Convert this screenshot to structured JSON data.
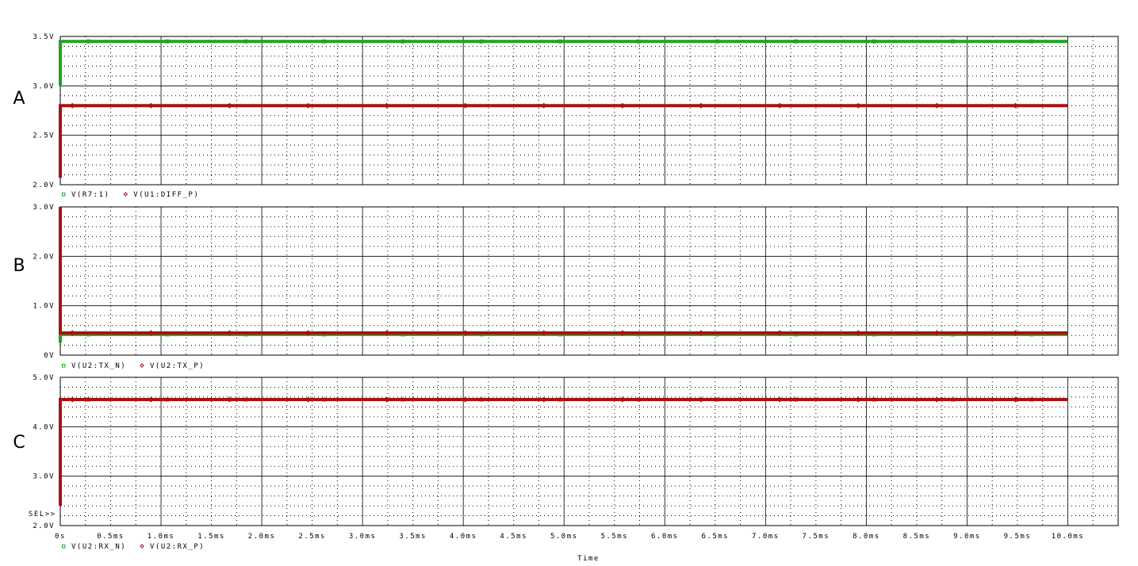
{
  "time_label": "Time",
  "sel_label": "SEL>>",
  "x_ticks": [
    "0s",
    "0.5ms",
    "1.0ms",
    "1.5ms",
    "2.0ms",
    "2.5ms",
    "3.0ms",
    "3.5ms",
    "4.0ms",
    "4.5ms",
    "5.0ms",
    "5.5ms",
    "6.0ms",
    "6.5ms",
    "7.0ms",
    "7.5ms",
    "8.0ms",
    "8.5ms",
    "9.0ms",
    "9.5ms",
    "10.0ms"
  ],
  "colors": {
    "green": "#1fa51f",
    "red": "#aa1111",
    "grid": "#000000"
  },
  "chart_data": [
    {
      "type": "line",
      "panel_label": "A",
      "x_unit": "ms",
      "xlim": [
        0,
        10.5
      ],
      "ylim": [
        2.0,
        3.5
      ],
      "y_ticks": [
        "2.0V",
        "2.5V",
        "3.0V",
        "3.5V"
      ],
      "y_tick_values": [
        2.0,
        2.5,
        3.0,
        3.5
      ],
      "series": [
        {
          "name": "V(R7:1)",
          "color": "green",
          "marker": "square",
          "x": [
            0,
            0,
            10.0
          ],
          "y": [
            3.0,
            3.45,
            3.45
          ]
        },
        {
          "name": "V(U1:DIFF_P)",
          "color": "red",
          "marker": "diamond",
          "x": [
            0,
            0,
            10.0
          ],
          "y": [
            2.07,
            2.8,
            2.8
          ]
        }
      ]
    },
    {
      "type": "line",
      "panel_label": "B",
      "x_unit": "ms",
      "xlim": [
        0,
        10.5
      ],
      "ylim": [
        0,
        3.0
      ],
      "y_ticks": [
        "0V",
        "1.0V",
        "2.0V",
        "3.0V"
      ],
      "y_tick_values": [
        0,
        1.0,
        2.0,
        3.0
      ],
      "series": [
        {
          "name": "V(U2:TX_N)",
          "color": "green",
          "marker": "square",
          "x": [
            0,
            0,
            10.0
          ],
          "y": [
            0.25,
            0.42,
            0.42
          ]
        },
        {
          "name": "V(U2:TX_P)",
          "color": "red",
          "marker": "diamond",
          "x": [
            0,
            0,
            10.0
          ],
          "y": [
            3.0,
            0.45,
            0.45
          ]
        }
      ]
    },
    {
      "type": "line",
      "panel_label": "C",
      "x_unit": "ms",
      "xlim": [
        0,
        10.5
      ],
      "ylim": [
        2.0,
        5.0
      ],
      "y_ticks": [
        "2.0V",
        "3.0V",
        "4.0V",
        "5.0V"
      ],
      "y_tick_values": [
        2.0,
        3.0,
        4.0,
        5.0
      ],
      "series": [
        {
          "name": "V(U2:RX_N)",
          "color": "green",
          "marker": "square",
          "x": [
            0,
            0,
            10.0
          ],
          "y": [
            4.55,
            4.55,
            4.55
          ]
        },
        {
          "name": "V(U2:RX_P)",
          "color": "red",
          "marker": "diamond",
          "x": [
            0,
            0,
            10.0
          ],
          "y": [
            2.4,
            4.55,
            4.55
          ]
        }
      ]
    }
  ]
}
